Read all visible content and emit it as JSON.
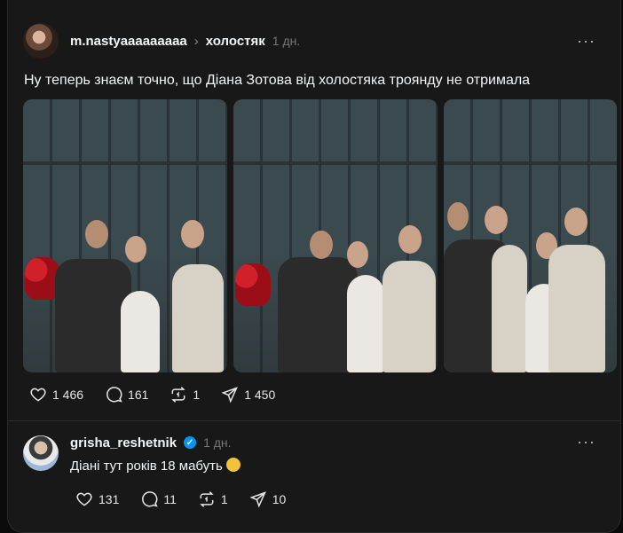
{
  "post": {
    "username": "m.nastyaaaaaaaaa",
    "separator": "›",
    "topic": "холостяк",
    "time": "1 дн.",
    "more": "···",
    "text": "Ну теперь знаєм точно, що Діана Зотова від холостяка троянду не отримала",
    "photos": [
      "photo-1",
      "photo-2",
      "photo-3"
    ],
    "actions": {
      "likes": "1 466",
      "comments": "161",
      "reposts": "1",
      "shares": "1 450"
    }
  },
  "reply": {
    "username": "grisha_reshetnik",
    "verified_mark": "✓",
    "time": "1 дн.",
    "more": "···",
    "text": "Діані тут років 18 мабуть",
    "actions": {
      "likes": "131",
      "comments": "11",
      "reposts": "1",
      "shares": "10"
    }
  },
  "icons": [
    "heart-icon",
    "comment-icon",
    "repost-icon",
    "share-icon",
    "more-icon",
    "verified-icon",
    "emoji-icon"
  ],
  "colors": {
    "background": "#181818",
    "text": "#f3f5f7",
    "muted": "#777777",
    "verified": "#0095f6"
  }
}
